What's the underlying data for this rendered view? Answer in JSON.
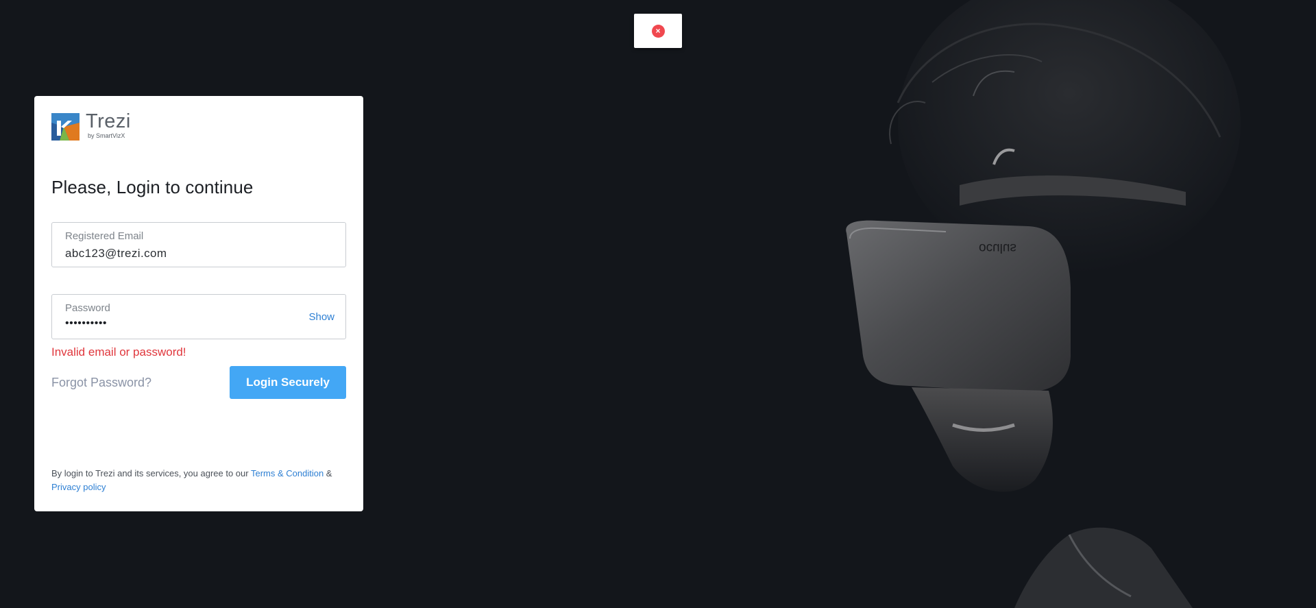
{
  "toast": {
    "icon": "error-x-icon",
    "symbol": "×",
    "color": "#f0484f"
  },
  "brand": {
    "name": "Trezi",
    "sub": "by SmartVizX"
  },
  "login": {
    "heading": "Please, Login to continue",
    "email_label": "Registered Email",
    "email_value": "abc123@trezi.com",
    "password_label": "Password",
    "password_mask": "••••••••••",
    "show_label": "Show",
    "error": "Invalid email or password!",
    "forgot_label": "Forgot Password?",
    "submit_label": "Login Securely"
  },
  "legal": {
    "prefix": "By login to Trezi and its services, you agree to our ",
    "terms": "Terms & Condition",
    "amp": " &",
    "privacy": "Privacy policy"
  },
  "photo": {
    "headset_text": "oculus"
  },
  "colors": {
    "background": "#13161b",
    "accent": "#43a7f5",
    "link": "#2d7fd3",
    "error": "#e0363c"
  }
}
